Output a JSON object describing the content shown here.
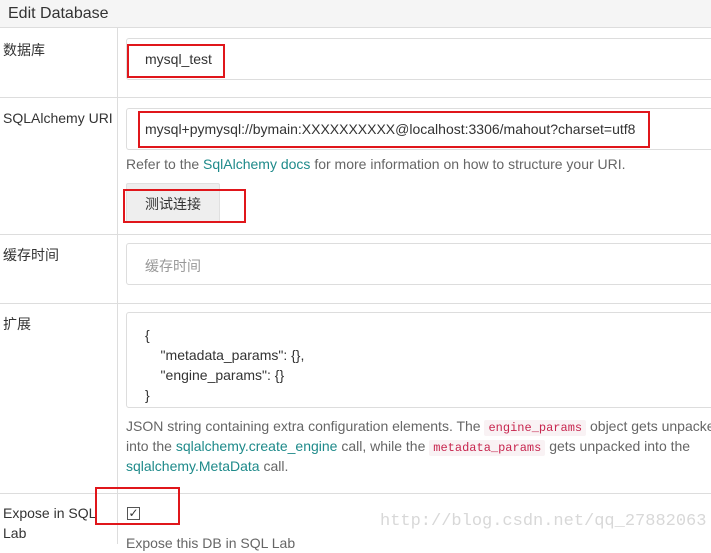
{
  "header": {
    "title": "Edit Database"
  },
  "fields": {
    "database_name": {
      "label": "数据库",
      "value": "mysql_test"
    },
    "sqlalchemy_uri": {
      "label": "SQLAlchemy URI",
      "value": "mysql+pymysql://bymain:XXXXXXXXXX@localhost:3306/mahout?charset=utf8",
      "help_prefix": "Refer to the ",
      "help_link": "SqlAlchemy docs",
      "help_suffix": " for more information on how to structure your URI."
    },
    "test_button": {
      "label": "测试连接"
    },
    "cache_timeout": {
      "label": "缓存时间",
      "placeholder": "缓存时间"
    },
    "extra": {
      "label": "扩展",
      "value": "{\n    \"metadata_params\": {},\n    \"engine_params\": {}\n}",
      "help_1a": "JSON string containing extra configuration elements. The ",
      "help_1_code": "engine_params",
      "help_1b": " object gets unpacked",
      "help_2a": "into the ",
      "help_2_link": "sqlalchemy.create_engine",
      "help_2b": " call, while the ",
      "help_2_code": "metadata_params",
      "help_2c": " gets unpacked into the",
      "help_3_link": "sqlalchemy.MetaData",
      "help_3b": " call."
    },
    "expose_in_sqllab": {
      "label_1": "Expose in SQL",
      "label_2": "Lab",
      "checked": true,
      "check_glyph": "✓",
      "help": "Expose this DB in SQL Lab"
    }
  },
  "watermark": "http://blog.csdn.net/qq_27882063",
  "colors": {
    "highlight": "#e0161b",
    "link": "#1e8a8a",
    "code": "#c7254e"
  }
}
